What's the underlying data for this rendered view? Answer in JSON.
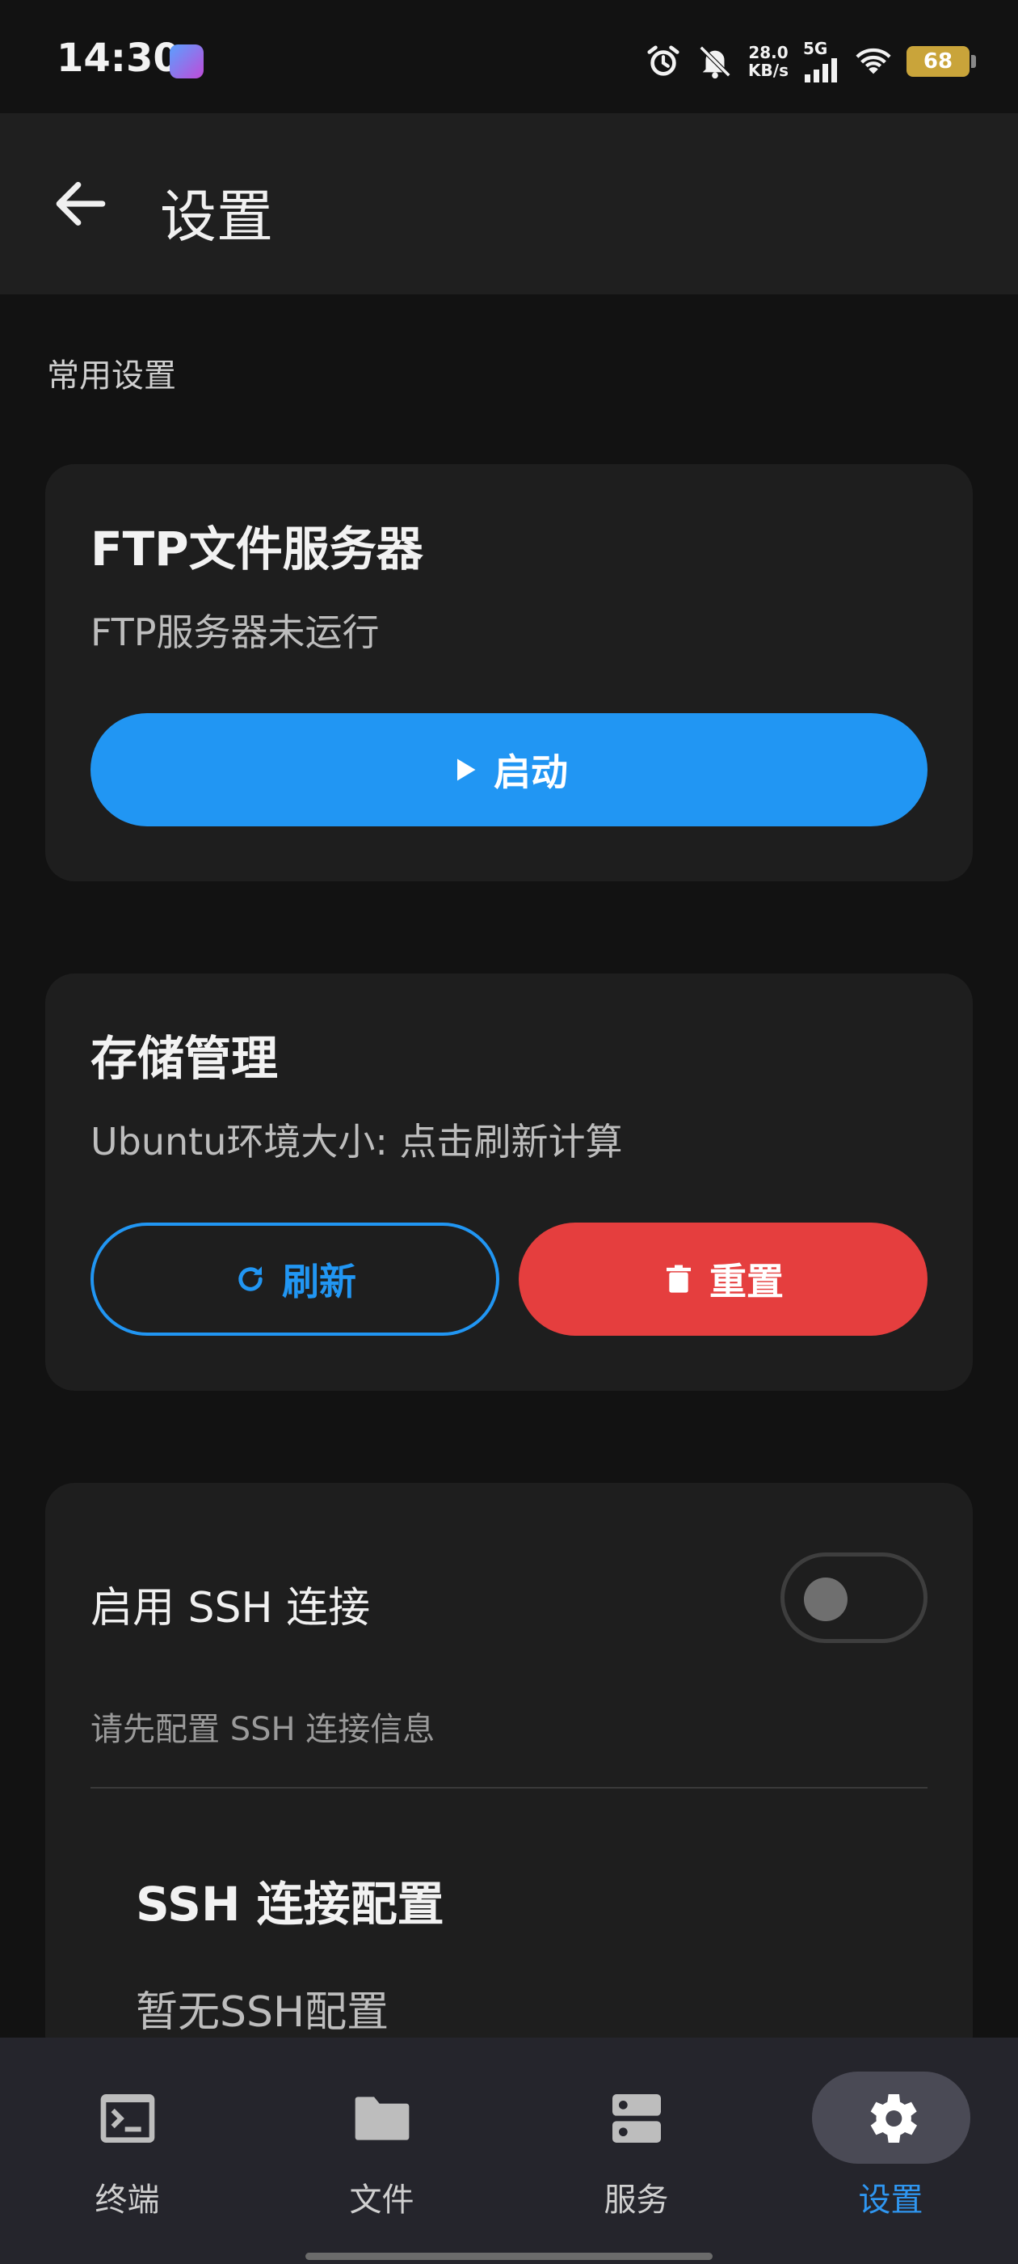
{
  "status_bar": {
    "time": "14:30",
    "net_speed_value": "28.0",
    "net_speed_unit": "KB/s",
    "network_type": "5G",
    "battery_level": "68",
    "icons": [
      "alarm-icon",
      "mute-icon",
      "signal-icon",
      "wifi-icon",
      "battery-icon"
    ]
  },
  "app_bar": {
    "title": "设置",
    "back_icon": "arrow-left-icon"
  },
  "section": {
    "label": "常用设置"
  },
  "ftp_card": {
    "title": "FTP文件服务器",
    "status": "FTP服务器未运行",
    "start_button": {
      "label": "启动",
      "icon": "play-icon"
    }
  },
  "storage_card": {
    "title": "存储管理",
    "info": "Ubuntu环境大小: 点击刷新计算",
    "refresh_button": {
      "label": "刷新",
      "icon": "refresh-icon"
    },
    "reset_button": {
      "label": "重置",
      "icon": "trash-icon"
    }
  },
  "ssh_card": {
    "enable_label": "启用 SSH 连接",
    "enabled": false,
    "hint": "请先配置 SSH 连接信息",
    "config_title": "SSH 连接配置",
    "config_empty": "暂无SSH配置"
  },
  "bottom_nav": {
    "items": [
      {
        "label": "终端",
        "icon": "terminal-icon",
        "active": false
      },
      {
        "label": "文件",
        "icon": "folder-icon",
        "active": false
      },
      {
        "label": "服务",
        "icon": "server-icon",
        "active": false
      },
      {
        "label": "设置",
        "icon": "gear-icon",
        "active": true
      }
    ]
  },
  "colors": {
    "background": "#121212",
    "surface": "#1e1e1e",
    "accent": "#2196f3",
    "danger": "#e53e3e"
  }
}
